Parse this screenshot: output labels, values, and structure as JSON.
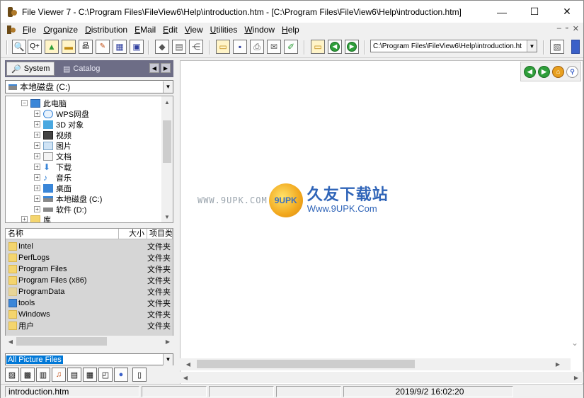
{
  "window": {
    "title": "File Viewer 7 - C:\\Program Files\\FileView6\\Help\\introduction.htm - [C:\\Program Files\\FileView6\\Help\\introduction.htm]",
    "minimize": "—",
    "maximize": "☐",
    "close": "✕"
  },
  "menu": {
    "items": [
      "File",
      "Organize",
      "Distribution",
      "EMail",
      "Edit",
      "View",
      "Utilities",
      "Window",
      "Help"
    ],
    "mdi_min": "–",
    "mdi_restore": "▫",
    "mdi_close": "✕"
  },
  "toolbar": {
    "path_value": "C:\\Program Files\\FileView6\\Help\\introduction.ht"
  },
  "left": {
    "tabs": {
      "system": "System",
      "catalog": "Catalog"
    },
    "drive": "本地磁盘 (C:)",
    "tree": [
      "此电脑",
      "WPS网盘",
      "3D 对象",
      "视频",
      "图片",
      "文档",
      "下载",
      "音乐",
      "桌面",
      "本地磁盘 (C:)",
      "软件 (D:)",
      "库"
    ],
    "list_headers": {
      "name": "名称",
      "size": "大小",
      "type": "项目类"
    },
    "files": [
      {
        "name": "Intel",
        "type": "文件夹"
      },
      {
        "name": "PerfLogs",
        "type": "文件夹"
      },
      {
        "name": "Program Files",
        "type": "文件夹"
      },
      {
        "name": "Program Files (x86)",
        "type": "文件夹"
      },
      {
        "name": "ProgramData",
        "type": "文件夹"
      },
      {
        "name": "tools",
        "type": "文件夹"
      },
      {
        "name": "Windows",
        "type": "文件夹"
      },
      {
        "name": "用户",
        "type": "文件夹"
      }
    ],
    "filter": "All Picture Files"
  },
  "watermark": {
    "www": "WWW.9UPK.COM",
    "logo": "9UPK",
    "cn": "久友下载站",
    "url": "Www.9UPK.Com"
  },
  "status": {
    "file": "introduction.htm",
    "datetime": "2019/9/2 16:02:20"
  },
  "colors": {
    "tab_strip": "#6d6d86",
    "selection": "#0078d7",
    "watermark_blue": "#2f64b8"
  }
}
